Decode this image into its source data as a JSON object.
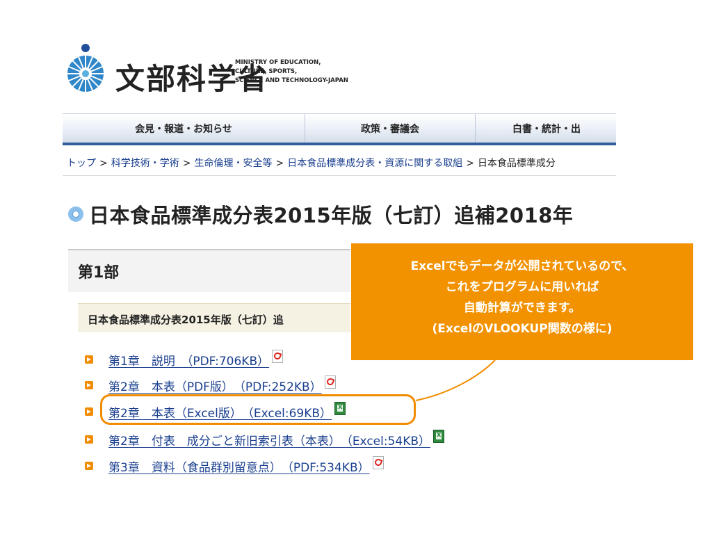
{
  "header": {
    "logo_kanji": "文部科学省",
    "logo_en": [
      "MINISTRY OF EDUCATION,",
      "CULTURE, SPORTS,",
      "SCIENCE AND TECHNOLOGY-JAPAN"
    ]
  },
  "nav": {
    "items": [
      {
        "label": "会見・報道・お知らせ"
      },
      {
        "label": "政策・審議会"
      },
      {
        "label": "白書・統計・出"
      }
    ]
  },
  "breadcrumb": {
    "items": [
      "トップ",
      "科学技術・学術",
      "生命倫理・安全等",
      "日本食品標準成分表・資源に関する取組",
      "日本食品標準成分"
    ],
    "separator": ">"
  },
  "page": {
    "title": "日本食品標準成分表2015年版（七訂）追補2018年"
  },
  "section": {
    "heading": "第1部",
    "subheading": "日本食品標準成分表2015年版（七訂）追"
  },
  "links": [
    {
      "label": "第1章　説明　（PDF:706KB）",
      "icon": "pdf-icon"
    },
    {
      "label": "第2章　本表（PDF版）　（PDF:252KB）",
      "icon": "pdf-icon"
    },
    {
      "label": "第2章　本表（Excel版）　（Excel:69KB）",
      "icon": "excel-icon"
    },
    {
      "label": "第2章　付表　成分ごと新旧索引表（本表）　（Excel:54KB）",
      "icon": "excel-icon"
    },
    {
      "label": "第3章　資料（食品群別留意点）　（PDF:534KB）",
      "icon": "pdf-icon"
    }
  ],
  "callout": {
    "lines": [
      "Excelでもデータが公開されているので、",
      "これをプログラムに用いれば",
      "自動計算ができます。",
      "(ExcelのVLOOKUP関数の様に)"
    ],
    "color": "#f29200"
  },
  "colors": {
    "accent": "#f08c00",
    "link": "#1a3f8f",
    "nav_border": "#2f5e9b"
  }
}
